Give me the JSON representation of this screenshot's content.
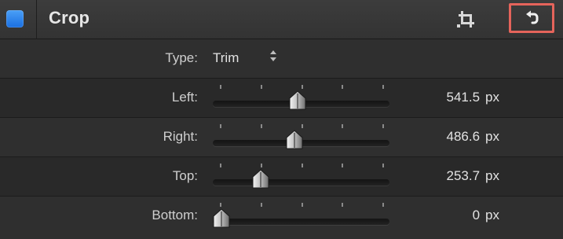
{
  "header": {
    "title": "Crop",
    "enabled": true,
    "accent_color": "#2f86f0",
    "crop_tool_icon": "crop-tool-icon",
    "reset_icon": "reset-arrow-icon",
    "highlight_color": "#e5645b"
  },
  "type_row": {
    "label": "Type:",
    "value": "Trim",
    "arrows": "↕"
  },
  "params": [
    {
      "label": "Left:",
      "value": "541.5",
      "unit": "px",
      "level": 0.48
    },
    {
      "label": "Right:",
      "value": "486.6",
      "unit": "px",
      "level": 0.46
    },
    {
      "label": "Top:",
      "value": "253.7",
      "unit": "px",
      "level": 0.27
    },
    {
      "label": "Bottom:",
      "value": "0",
      "unit": "px",
      "level": 0.05
    }
  ]
}
